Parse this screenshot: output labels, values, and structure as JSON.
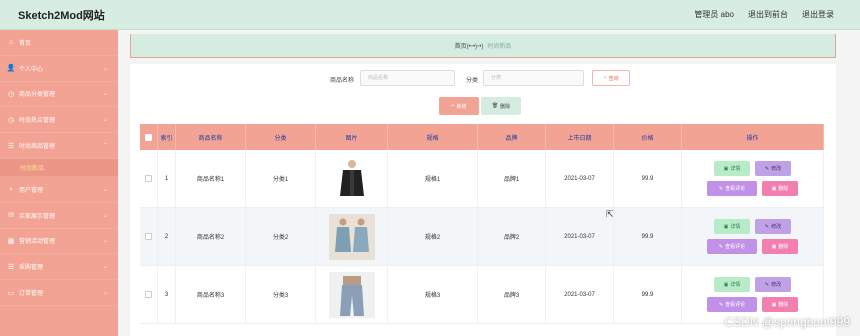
{
  "app": {
    "title": "Sketch2Mod网站"
  },
  "topbar": {
    "admin": "管理员 abo",
    "front": "退出到前台",
    "logout": "退出登录"
  },
  "sidebar": {
    "items": [
      {
        "label": "首页",
        "icon": "home-icon"
      },
      {
        "label": "个人中心",
        "icon": "user-icon"
      },
      {
        "label": "商品分类管理",
        "icon": "clock-icon"
      },
      {
        "label": "时尚热点管理",
        "icon": "clock-icon"
      },
      {
        "label": "时尚商品管理",
        "icon": "list-icon"
      },
      {
        "label": "时尚新品",
        "icon": ""
      },
      {
        "label": "用户管理",
        "icon": "trash-icon"
      },
      {
        "label": "买家展示管理",
        "icon": "mail-icon"
      },
      {
        "label": "营销活动管理",
        "icon": "grid-icon"
      },
      {
        "label": "采购管理",
        "icon": "list-icon"
      },
      {
        "label": "订单管理",
        "icon": "card-icon"
      }
    ]
  },
  "breadcrumb": {
    "home": "首页(•ᵕ•)ᵕ•)",
    "current": "时尚新品"
  },
  "search": {
    "name_label": "商品名称",
    "name_placeholder": "商品名称",
    "category_label": "分类",
    "category_placeholder": "分类",
    "query_button": "查询"
  },
  "ops": {
    "add": "新增",
    "delete": "删除"
  },
  "table": {
    "headers": [
      "索引",
      "商品名称",
      "分类",
      "图片",
      "规格",
      "品牌",
      "上市日期",
      "价格",
      "操作"
    ],
    "rows": [
      {
        "index": "1",
        "name": "商品名称1",
        "category": "分类1",
        "spec": "规格1",
        "brand": "品牌1",
        "date": "2021-03-07",
        "price": "99.9"
      },
      {
        "index": "2",
        "name": "商品名称2",
        "category": "分类2",
        "spec": "规格2",
        "brand": "品牌2",
        "date": "2021-03-07",
        "price": "99.9"
      },
      {
        "index": "3",
        "name": "商品名称3",
        "category": "分类3",
        "spec": "规格3",
        "brand": "品牌3",
        "date": "2021-03-07",
        "price": "99.9"
      }
    ],
    "actions": {
      "detail": "详情",
      "edit": "修改",
      "comment": "查看评论",
      "remove": "删除"
    }
  },
  "watermark": "CSDN @springboot999",
  "colors": {
    "sidebar": "#f2a394",
    "topbar": "#d8ede2",
    "header": "#f2a394"
  }
}
